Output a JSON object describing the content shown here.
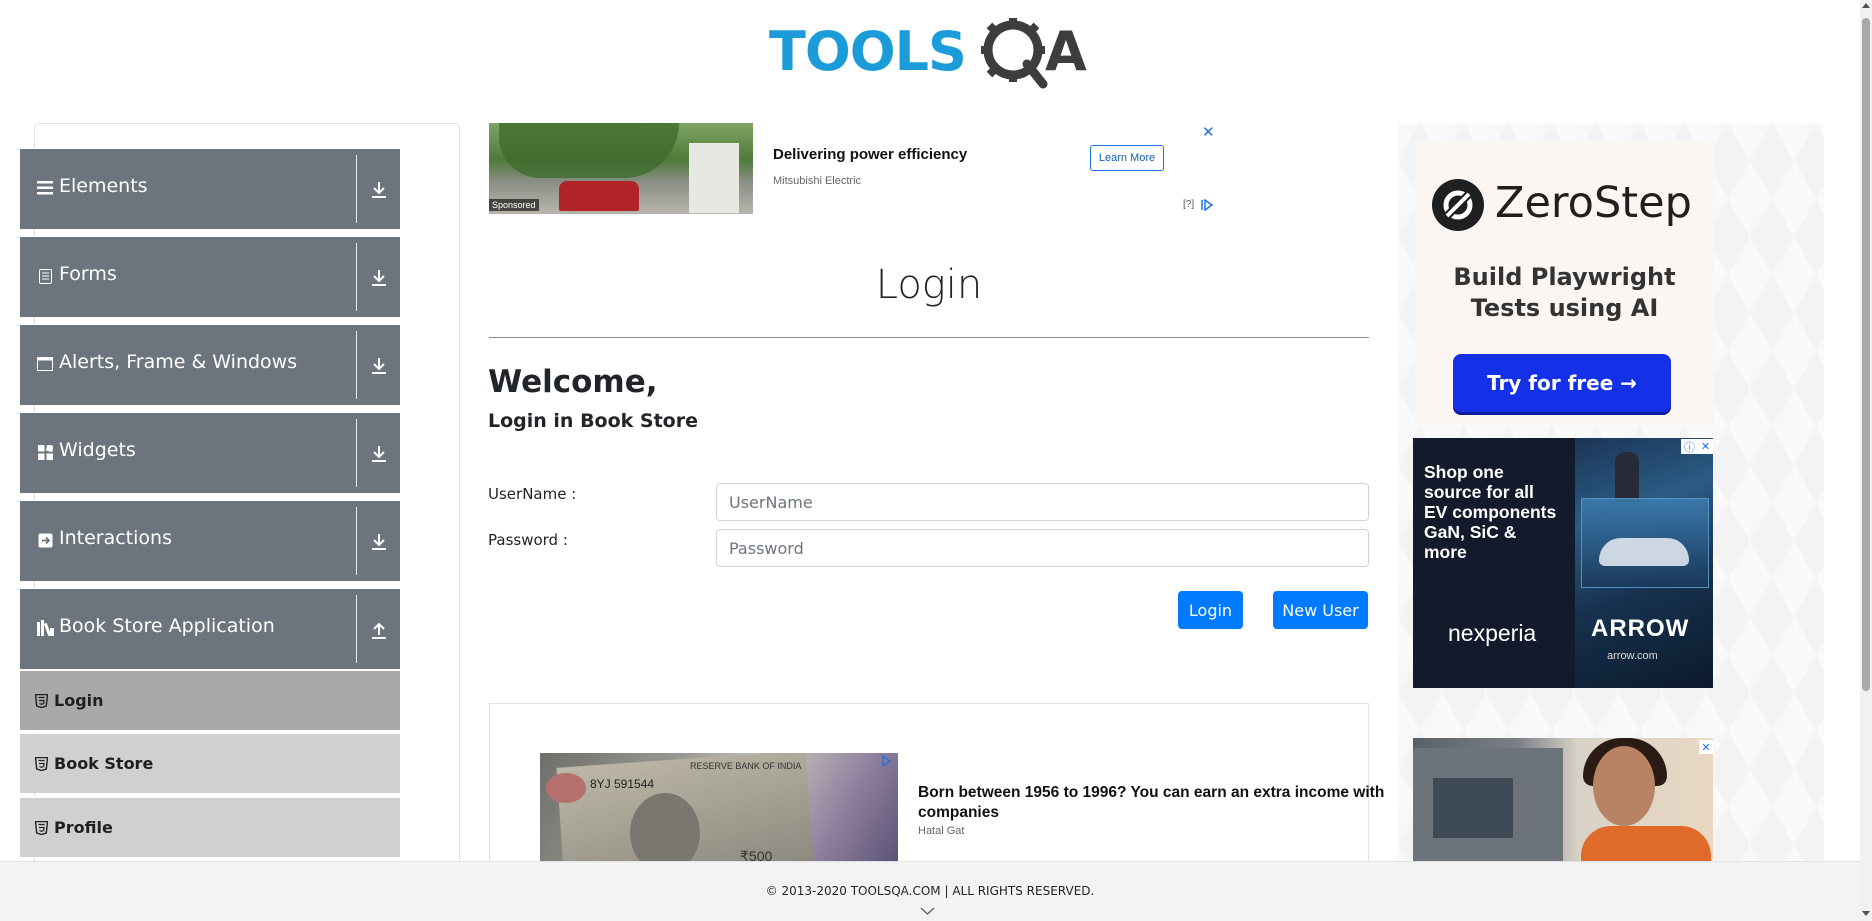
{
  "header": {
    "logo_text_tools": "TOOLS",
    "logo_text_qa": "QA",
    "logo_colors": {
      "tools": "#1b9bd8",
      "qa": "#3d3d3d"
    }
  },
  "sidebar": {
    "groups": [
      {
        "label": "Elements",
        "icon": "hamburger-icon",
        "state": "collapsed"
      },
      {
        "label": "Forms",
        "icon": "document-icon",
        "state": "collapsed"
      },
      {
        "label": "Alerts, Frame & Windows",
        "icon": "window-icon",
        "state": "collapsed"
      },
      {
        "label": "Widgets",
        "icon": "widgets-icon",
        "state": "collapsed"
      },
      {
        "label": "Interactions",
        "icon": "interactions-icon",
        "state": "collapsed"
      },
      {
        "label": "Book Store Application",
        "icon": "books-icon",
        "state": "expanded"
      }
    ],
    "subitems": [
      {
        "label": "Login",
        "active": true
      },
      {
        "label": "Book Store",
        "active": false
      },
      {
        "label": "Profile",
        "active": false
      }
    ],
    "colors": {
      "group_bg": "#6c757d",
      "active_sub_bg": "#a9a9a9",
      "sub_bg": "#d0d0d0"
    }
  },
  "top_ad": {
    "headline": "Delivering power efficiency",
    "advertiser": "Mitsubishi Electric",
    "cta": "Learn More",
    "sponsored": "Sponsored",
    "info": "[?]",
    "close": "✕"
  },
  "main": {
    "title": "Login",
    "welcome": "Welcome,",
    "subheading": "Login in Book Store",
    "username_label": "UserName :",
    "username_placeholder": "UserName",
    "username_value": "",
    "password_label": "Password :",
    "password_placeholder": "Password",
    "password_value": "",
    "login_button": "Login",
    "new_user_button": "New User",
    "accent_color": "#007bff"
  },
  "bottom_ad": {
    "headline": "Born between 1956 to 1996? You can earn an extra income with companies",
    "advertiser": "Hatal Gat",
    "note_text_top": "RESERVE BANK OF INDIA",
    "note_serial": "8YJ 591544",
    "note_value": "₹500"
  },
  "right_ads": {
    "zerostep": {
      "brand": "ZeroStep",
      "tagline_line1": "Build Playwright",
      "tagline_line2": "Tests using AI",
      "cta": "Try for free →",
      "cta_color": "#1431e8"
    },
    "nexperia": {
      "copy_lines": [
        "Shop one",
        "source for all",
        "EV components",
        "GaN, SiC &",
        "more"
      ],
      "brand": "nexperia",
      "partner": "ARROW",
      "partner_url": "arrow.com"
    },
    "third_close": "✕"
  },
  "footer": {
    "copyright": "© 2013-2020 TOOLSQA.COM | ALL RIGHTS RESERVED."
  }
}
